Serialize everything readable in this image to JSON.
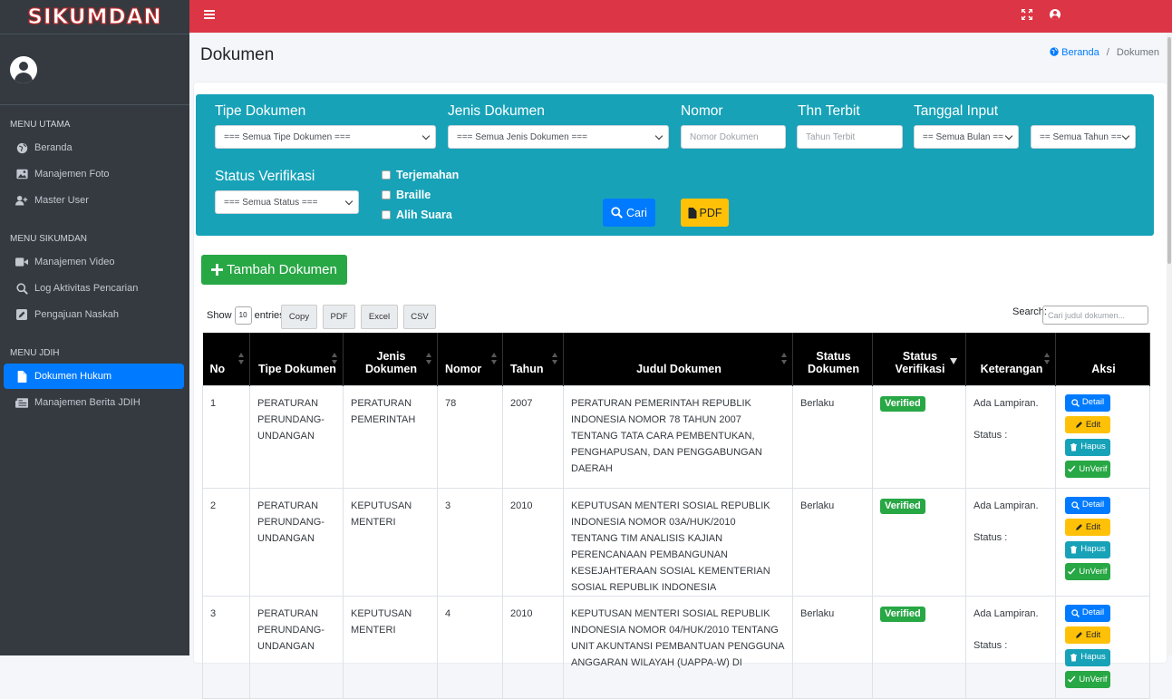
{
  "brand": "SIKUMDAN",
  "sidebar": {
    "sections": [
      {
        "header": "MENU UTAMA",
        "items": [
          {
            "label": "Beranda",
            "icon": "globe-icon"
          },
          {
            "label": "Manajemen Foto",
            "icon": "image-icon"
          },
          {
            "label": "Master User",
            "icon": "user-plus-icon"
          }
        ]
      },
      {
        "header": "MENU SIKUMDAN",
        "items": [
          {
            "label": "Manajemen Video",
            "icon": "video-icon"
          },
          {
            "label": "Log Aktivitas Pencarian",
            "icon": "search-icon"
          },
          {
            "label": "Pengajuan Naskah",
            "icon": "pen-square-icon"
          }
        ]
      },
      {
        "header": "MENU JDIH",
        "items": [
          {
            "label": "Dokumen Hukum",
            "icon": "file-icon",
            "active": true
          },
          {
            "label": "Manajemen Berita JDIH",
            "icon": "newspaper-icon"
          }
        ]
      }
    ]
  },
  "page": {
    "title": "Dokumen",
    "breadcrumb": {
      "home": "Beranda",
      "sep": "/",
      "current": "Dokumen"
    }
  },
  "filter": {
    "tipe_label": "Tipe Dokumen",
    "tipe_value": "=== Semua Tipe Dokumen ===",
    "jenis_label": "Jenis Dokumen",
    "jenis_value": "=== Semua Jenis Dokumen ===",
    "nomor_label": "Nomor",
    "nomor_placeholder": "Nomor Dokumen",
    "thn_label": "Thn Terbit",
    "thn_placeholder": "Tahun Terbit",
    "tanggal_label": "Tanggal Input",
    "bulan_value": "== Semua Bulan ==",
    "tahun_value": "== Semua Tahun ==",
    "status_label": "Status Verifikasi",
    "status_value": "=== Semua Status ===",
    "checkboxes": [
      "Terjemahan",
      "Braille",
      "Alih Suara"
    ],
    "cari_label": "Cari",
    "pdf_label": "PDF"
  },
  "toolbar": {
    "add_label": "Tambah Dokumen",
    "show_label": "Show",
    "entries_value": "10",
    "entries_label": "entries",
    "export_buttons": [
      "Copy",
      "PDF",
      "Excel",
      "CSV"
    ],
    "search_label": "Search:",
    "search_placeholder": "Cari judul dokumen..."
  },
  "table": {
    "headers": [
      "No",
      "Tipe Dokumen",
      "Jenis Dokumen",
      "Nomor",
      "Tahun",
      "Judul Dokumen",
      "Status Dokumen",
      "Status Verifikasi",
      "Keterangan",
      "Aksi"
    ],
    "rows": [
      {
        "no": "1",
        "tipe": "PERATURAN PERUNDANG-UNDANGAN",
        "jenis": "PERATURAN PEMERINTAH",
        "nomor": "78",
        "tahun": "2007",
        "judul": "PERATURAN PEMERINTAH REPUBLIK INDONESIA NOMOR 78 TAHUN 2007 TENTANG TATA CARA PEMBENTUKAN, PENGHAPUSAN, DAN PENGGABUNGAN DAERAH",
        "status": "Berlaku",
        "verifikasi": "Verified",
        "ket1": "Ada Lampiran.",
        "ket2": "Status :"
      },
      {
        "no": "2",
        "tipe": "PERATURAN PERUNDANG-UNDANGAN",
        "jenis": "KEPUTUSAN MENTERI",
        "nomor": "3",
        "tahun": "2010",
        "judul": "KEPUTUSAN MENTERI SOSIAL REPUBLIK INDONESIA NOMOR 03A/HUK/2010 TENTANG TIM ANALISIS KAJIAN PERENCANAAN PEMBANGUNAN KESEJAHTERAAN SOSIAL KEMENTERIAN SOSIAL REPUBLIK INDONESIA",
        "status": "Berlaku",
        "verifikasi": "Verified",
        "ket1": "Ada Lampiran.",
        "ket2": "Status :"
      },
      {
        "no": "3",
        "tipe": "PERATURAN PERUNDANG-UNDANGAN",
        "jenis": "KEPUTUSAN MENTERI",
        "nomor": "4",
        "tahun": "2010",
        "judul": "KEPUTUSAN MENTERI SOSIAL REPUBLIK INDONESIA NOMOR 04/HUK/2010 TENTANG UNIT AKUNTANSI PEMBANTUAN PENGGUNA ANGGARAN WILAYAH (UAPPA-W) DI",
        "status": "Berlaku",
        "verifikasi": "Verified",
        "ket1": "Ada Lampiran.",
        "ket2": "Status :"
      }
    ],
    "actions": [
      "Detail",
      "Edit",
      "Hapus",
      "UnVerif"
    ]
  },
  "colors": {
    "topbar": "#dc3545",
    "filter_bg": "#17a2b8",
    "sidebar": "#343a40",
    "active": "#007bff"
  }
}
